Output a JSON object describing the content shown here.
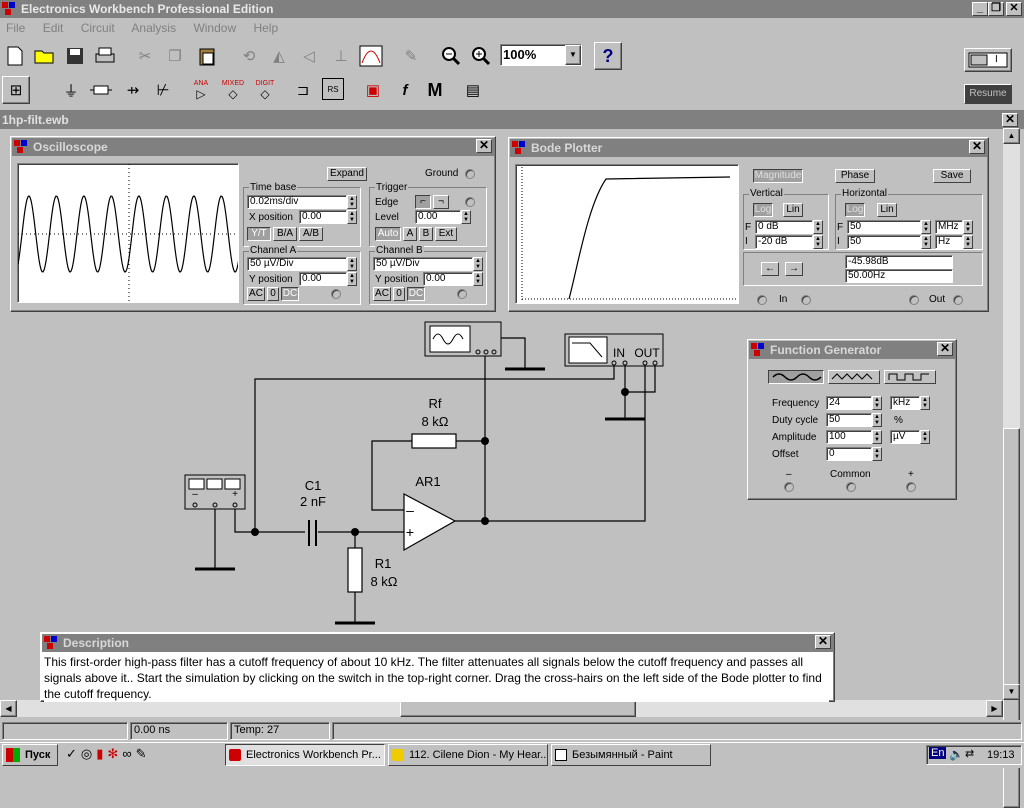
{
  "app": {
    "title": "Electronics Workbench Professional Edition",
    "document_title": "1hp-filt.ewb"
  },
  "menu": {
    "items": [
      "File",
      "Edit",
      "Circuit",
      "Analysis",
      "Window",
      "Help"
    ]
  },
  "toolbar": {
    "zoom": "100%",
    "help": "?",
    "resume": "Resume",
    "switch_label": "I",
    "meter_labels": [
      "ANA",
      "MIXED",
      "DIGIT"
    ],
    "misc_label": "M"
  },
  "oscilloscope": {
    "title": "Oscilloscope",
    "expand": "Expand",
    "ground": "Ground",
    "time_base_label": "Time base",
    "time_base": "0.02ms/div",
    "x_position_label": "X position",
    "x_position": "0.00",
    "modes": [
      "Y/T",
      "B/A",
      "A/B"
    ],
    "trigger_label": "Trigger",
    "edge_label": "Edge",
    "level_label": "Level",
    "level": "0.00",
    "trigger_sources": [
      "Auto",
      "A",
      "B",
      "Ext"
    ],
    "channel_a_label": "Channel A",
    "channel_a": "50 µV/Div",
    "y_position_label": "Y position",
    "channel_a_ypos": "0.00",
    "channel_b_label": "Channel B",
    "channel_b": "50 µV/Div",
    "channel_b_ypos": "0.00",
    "coupling": [
      "AC",
      "0",
      "DC"
    ]
  },
  "bode": {
    "title": "Bode Plotter",
    "magnitude": "Magnitude",
    "phase": "Phase",
    "save": "Save",
    "vertical_label": "Vertical",
    "horizontal_label": "Horizontal",
    "log": "Log",
    "lin": "Lin",
    "f_label": "F",
    "i_label": "I",
    "v_final": "0 dB",
    "v_initial": "-20 dB",
    "h_final": "50",
    "h_final_unit": "MHz",
    "h_initial": "50",
    "h_initial_unit": "Hz",
    "readout_db": "-45.98dB",
    "readout_freq": "50.00Hz",
    "in_label": "In",
    "out_label": "Out",
    "arrow_left": "←",
    "arrow_right": "→"
  },
  "function_generator": {
    "title": "Function Generator",
    "frequency_label": "Frequency",
    "frequency": "24",
    "frequency_unit": "kHz",
    "duty_label": "Duty cycle",
    "duty": "50",
    "duty_unit": "%",
    "amplitude_label": "Amplitude",
    "amplitude": "100",
    "amplitude_unit": "µV",
    "offset_label": "Offset",
    "offset": "0",
    "minus": "–",
    "common": "Common",
    "plus": "+"
  },
  "circuit": {
    "rf_name": "Rf",
    "rf_value": "8 kΩ",
    "c1_name": "C1",
    "c1_value": "2 nF",
    "ar1_name": "AR1",
    "r1_name": "R1",
    "r1_value": "8 kΩ",
    "bode_in": "IN",
    "bode_out": "OUT",
    "opamp_minus": "–",
    "opamp_plus": "+"
  },
  "description": {
    "title": "Description",
    "text": "This first-order high-pass filter has a cutoff frequency of about 10 kHz. The filter attenuates all signals below the cutoff frequency and passes all signals above it.. Start the simulation by clicking on the switch in the top-right corner. Drag the cross-hairs on the left side of the Bode plotter to find the cutoff frequency."
  },
  "status": {
    "time": "0.00 ns",
    "temp": "Temp:  27"
  },
  "taskbar": {
    "start": "Пуск",
    "tasks": [
      "Electronics Workbench Pr...",
      "112. Cilene Dion - My Hear...",
      "Безымянный - Paint"
    ],
    "lang": "En",
    "clock": "19:13"
  },
  "colors": {
    "title_inactive": "#808080",
    "desktop": "#c0c0c0",
    "screen": "#ffffff"
  }
}
